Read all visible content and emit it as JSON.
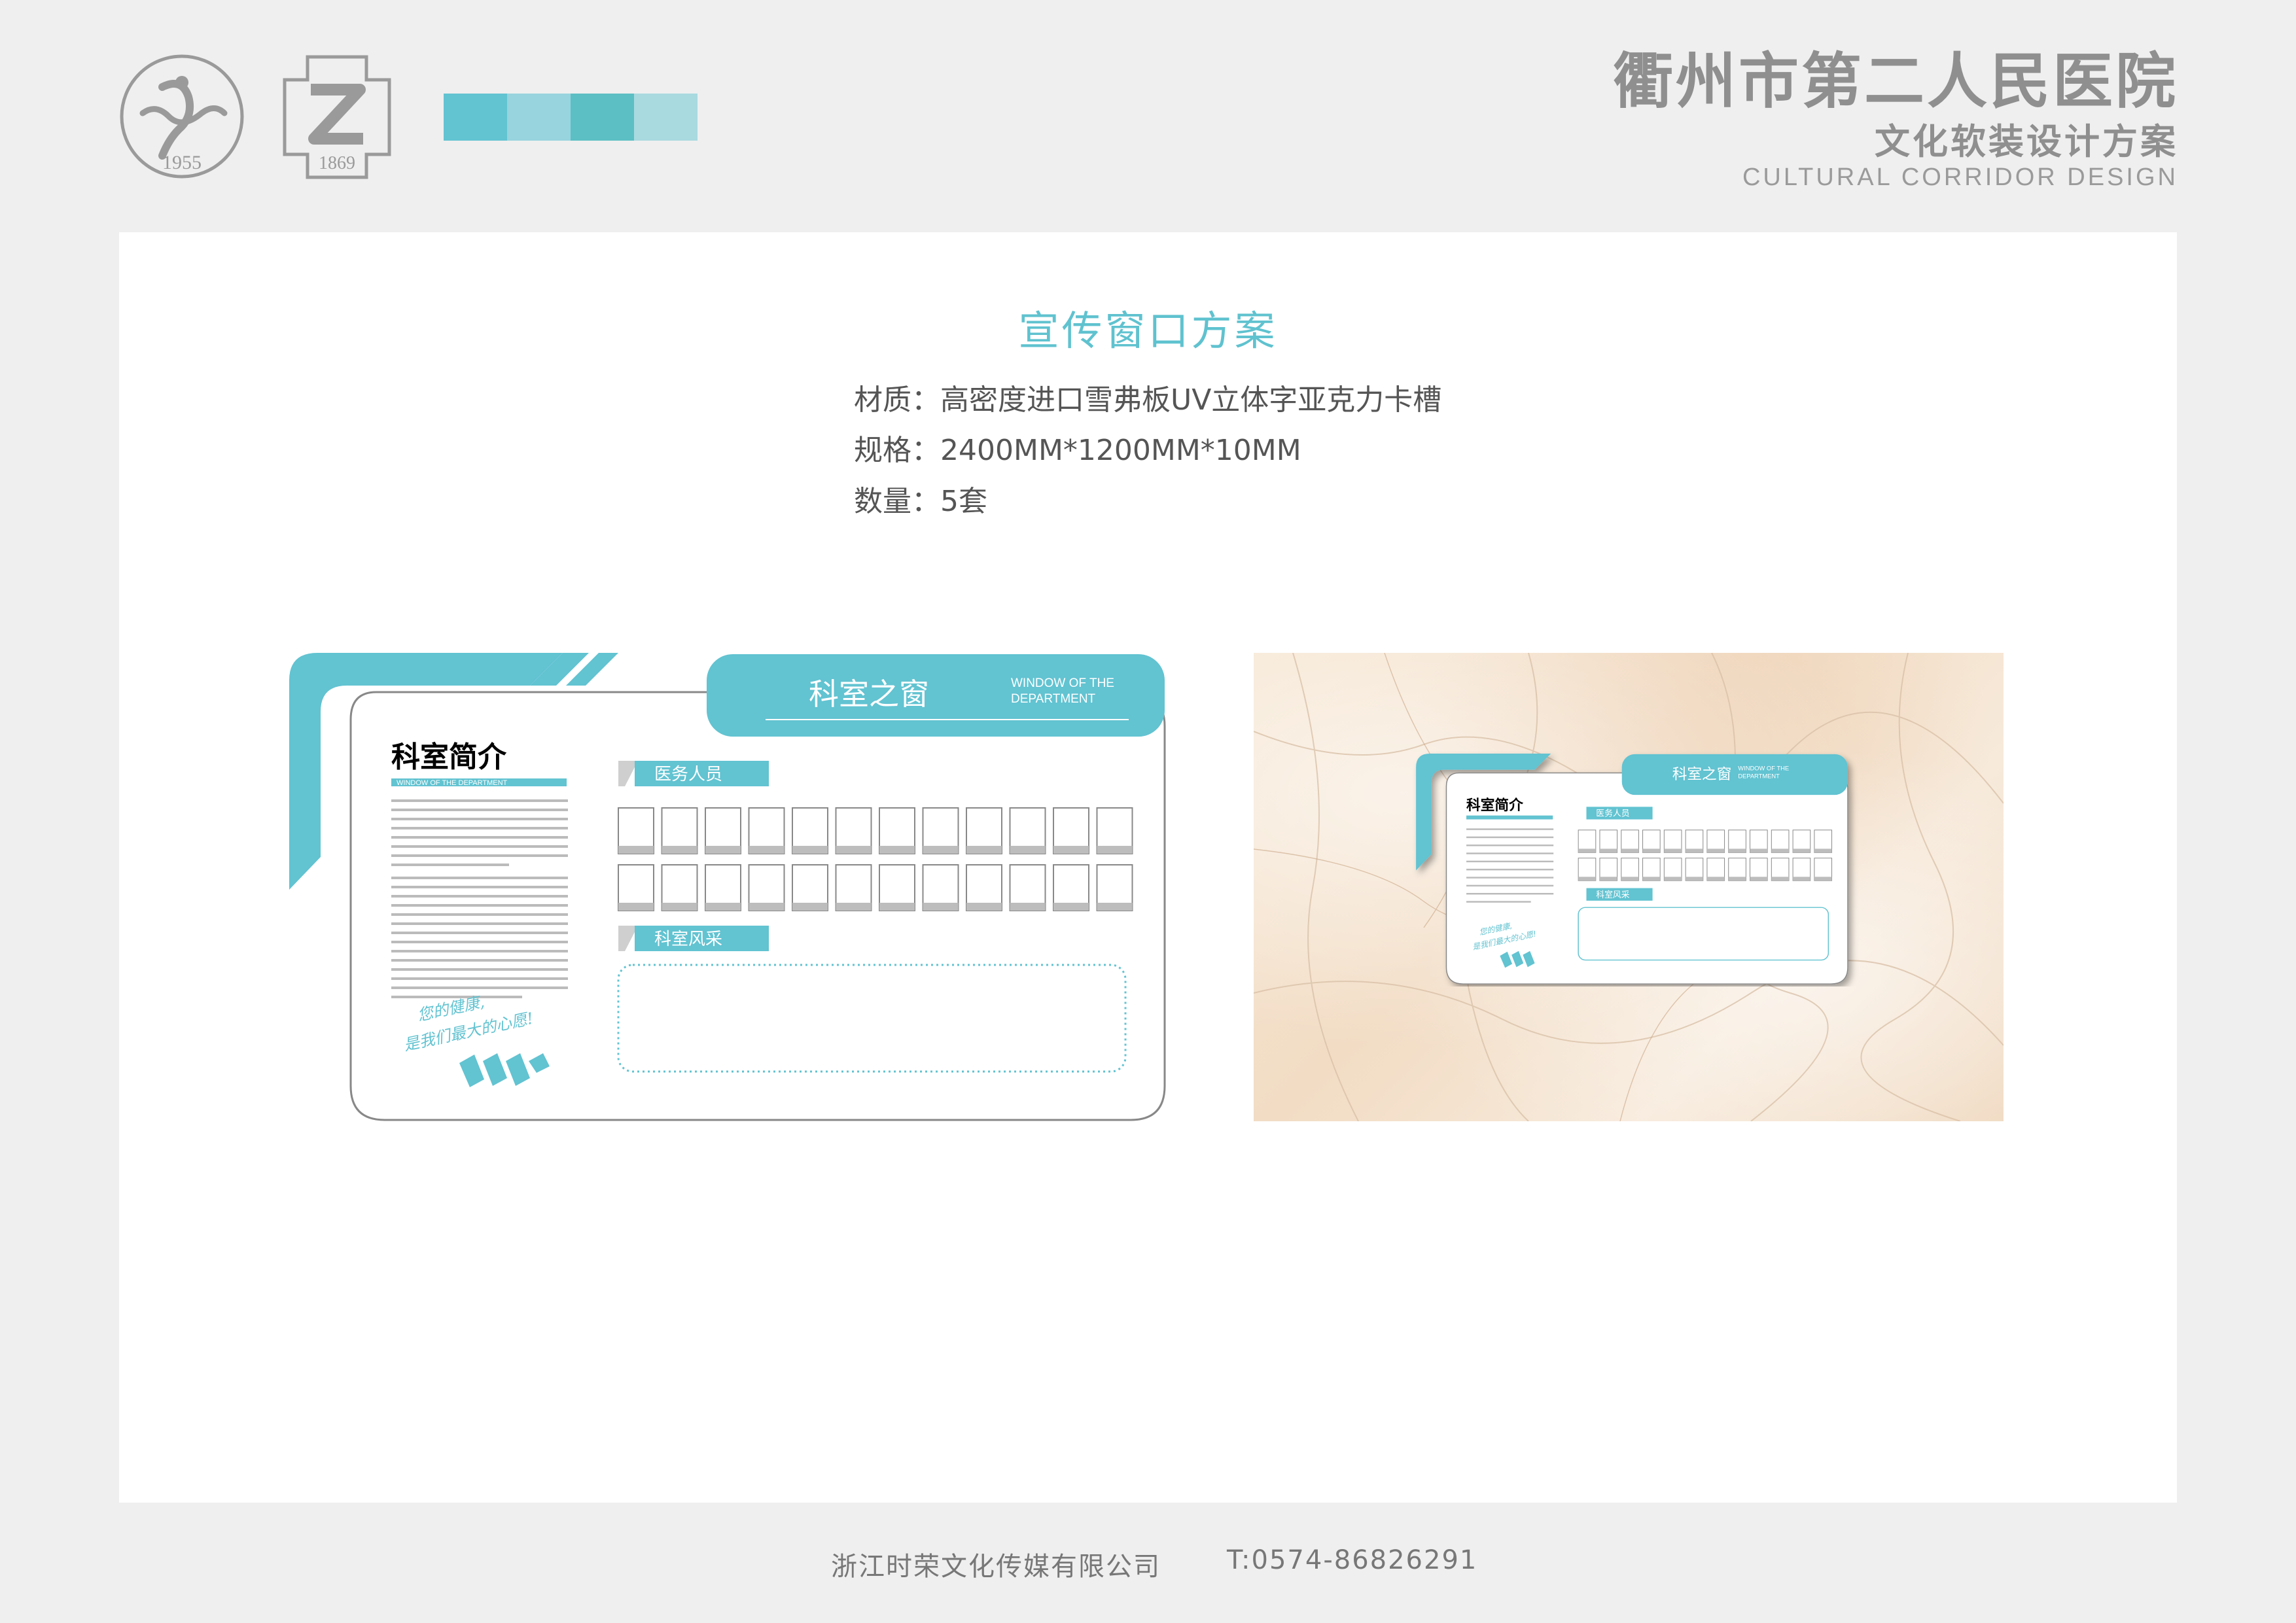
{
  "header": {
    "logo1_year": "1955",
    "logo2_year": "1869",
    "title": "衢州市第二人民医院",
    "subtitle": "文化软装设计方案",
    "subtitle_en": "CULTURAL CORRIDOR DESIGN"
  },
  "colors": {
    "accent": "#5fc2cf",
    "swatches": [
      "#62c3d1",
      "#98d4de",
      "#5cbfc4",
      "#a8dae0"
    ],
    "gray_title": "#8f8f8f",
    "marble": "#f4e3cf"
  },
  "section": {
    "title": "宣传窗口方案",
    "material": "材质：高密度进口雪弗板UV立体字亚克力卡槽",
    "spec": "规格：2400MM*1200MM*10MM",
    "quantity": "数量：5套"
  },
  "board": {
    "window_title": "科室之窗",
    "window_en_1": "WINDOW OF THE",
    "window_en_2": "DEPARTMENT",
    "intro_title": "科室简介",
    "intro_en": "WINDOW OF THE DEPARTMENT",
    "staff_label": "医务人员",
    "style_label": "科室风采",
    "slogan_1": "您的健康,",
    "slogan_2": "是我们最大的心愿!"
  },
  "footer": {
    "company": "浙江时荣文化传媒有限公司",
    "phone": "T:0574-86826291"
  }
}
